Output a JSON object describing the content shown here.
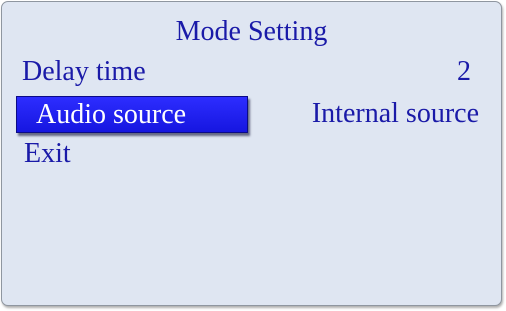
{
  "title": "Mode Setting",
  "menu": {
    "items": [
      {
        "label": "Delay time",
        "value": "2"
      },
      {
        "label": "Audio source",
        "value": "Internal source",
        "selected": true
      },
      {
        "label": "Exit"
      }
    ]
  },
  "colors": {
    "background": "#dfe6f2",
    "text": "#1a1aa8",
    "highlight": "#1f1ff0",
    "highlight_text": "#ffffff"
  }
}
